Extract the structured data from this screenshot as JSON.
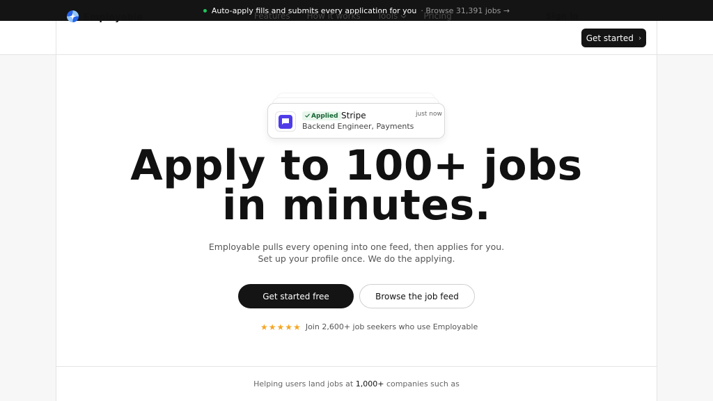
{
  "announcement": {
    "text": "Auto-apply fills and submits every application for you",
    "link": "· Browse 31,391 jobs →"
  },
  "nav": {
    "brand": "Employable",
    "links": [
      "Features",
      "How it works",
      "Tools",
      "Pricing"
    ],
    "sign_in": "Sign in",
    "get_started": "Get started"
  },
  "notification": {
    "status": "Applied",
    "company": "Stripe",
    "role": "Backend Engineer, Payments",
    "time": "just now"
  },
  "hero": {
    "headline_line1": "Apply to 100+ jobs",
    "headline_line2": "in minutes.",
    "subtext": "Employable pulls every opening into one feed, then applies for you. Set up your profile once. We do the applying.",
    "primary_cta": "Get started free",
    "secondary_cta": "Browse the job feed",
    "rating_stars": 5,
    "social_proof": "Join 2,600+ job seekers who use Employable"
  },
  "logos_section": {
    "prefix": "Helping users land jobs at",
    "count": "1,000+",
    "suffix": "companies such as"
  },
  "colors": {
    "accent_dark": "#141414",
    "status_green": "#22c55e",
    "star": "#f5a623",
    "stripe_purple": "#4f3ce8"
  }
}
